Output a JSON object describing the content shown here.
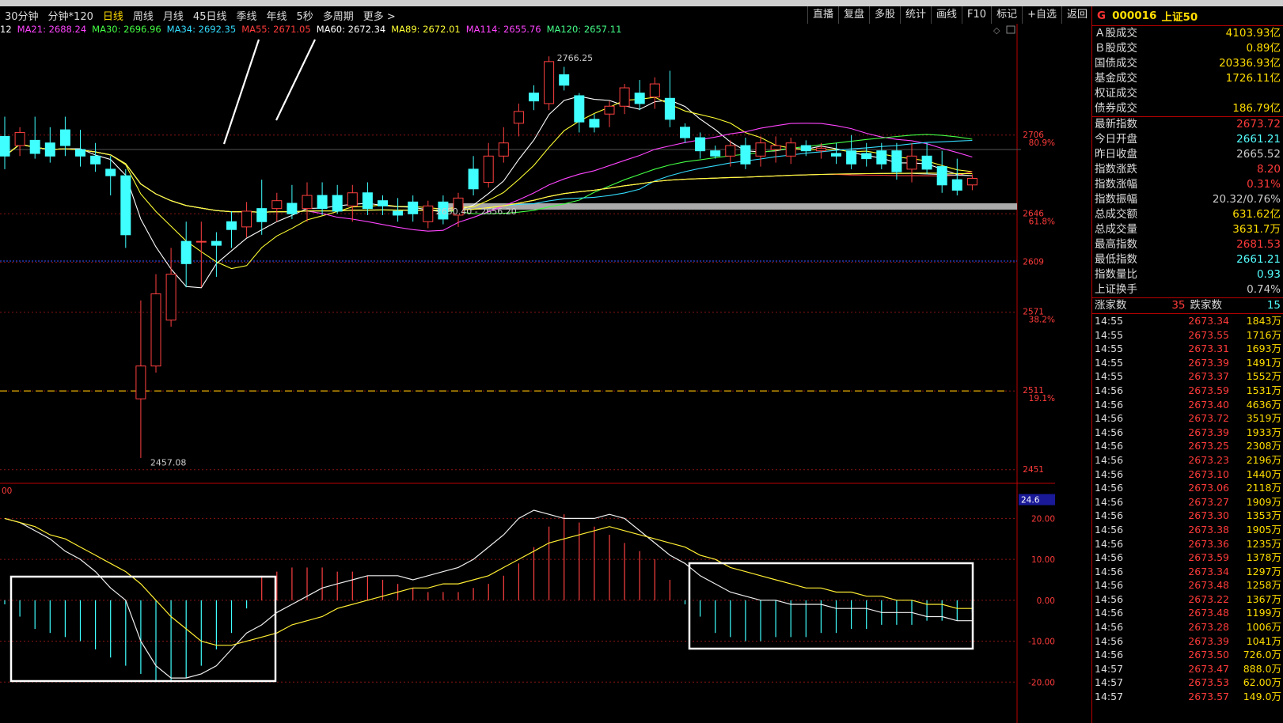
{
  "toolbar": {
    "periods": [
      "30分钟",
      "分钟*120",
      "日线",
      "周线",
      "月线",
      "45日线",
      "季线",
      "年线",
      "5秒",
      "多周期",
      "更多 >"
    ],
    "active_period": "日线",
    "tools": [
      "直播",
      "复盘",
      "多股",
      "统计",
      "画线",
      "F10",
      "标记",
      "+自选",
      "返回"
    ]
  },
  "ma_legend": [
    {
      "label": "12",
      "color": "#ffffff"
    },
    {
      "label": "MA21: 2688.24",
      "color": "#ff44ff"
    },
    {
      "label": "MA30: 2696.96",
      "color": "#44ff44"
    },
    {
      "label": "MA34: 2692.35",
      "color": "#33ddff"
    },
    {
      "label": "MA55: 2671.05",
      "color": "#ff3b3b"
    },
    {
      "label": "MA60: 2672.34",
      "color": "#ffffff"
    },
    {
      "label": "MA89: 2672.01",
      "color": "#ffff33"
    },
    {
      "label": "MA114: 2655.76",
      "color": "#ff44ff"
    },
    {
      "label": "MA120: 2657.11",
      "color": "#44ff88"
    }
  ],
  "chart_data": {
    "type": "candlestick",
    "price_axis_ticks": [
      {
        "value": "2706",
        "pct": "80.9%"
      },
      {
        "value": "2646",
        "pct": "61.8%"
      },
      {
        "value": "2609",
        "pct": ""
      },
      {
        "value": "2571",
        "pct": "38.2%"
      },
      {
        "value": "2511",
        "pct": "19.1%"
      },
      {
        "value": "2451",
        "pct": ""
      }
    ],
    "ylim": [
      2440,
      2780
    ],
    "annotations": {
      "high": "2766.25",
      "low": "2457.08",
      "range": "2650.40 - 2656.20"
    },
    "candles": [
      [
        2705,
        2720,
        2680,
        2690
      ],
      [
        2698,
        2712,
        2690,
        2708
      ],
      [
        2702,
        2720,
        2688,
        2692
      ],
      [
        2700,
        2712,
        2685,
        2690
      ],
      [
        2710,
        2720,
        2690,
        2698
      ],
      [
        2695,
        2710,
        2682,
        2690
      ],
      [
        2690,
        2700,
        2678,
        2684
      ],
      [
        2680,
        2690,
        2660,
        2675
      ],
      [
        2675,
        2680,
        2620,
        2630
      ],
      [
        2505,
        2580,
        2460,
        2530
      ],
      [
        2530,
        2600,
        2525,
        2585
      ],
      [
        2565,
        2620,
        2560,
        2600
      ],
      [
        2625,
        2640,
        2590,
        2608
      ],
      [
        2625,
        2640,
        2590,
        2625
      ],
      [
        2625,
        2632,
        2598,
        2622
      ],
      [
        2640,
        2648,
        2620,
        2634
      ],
      [
        2636,
        2655,
        2628,
        2648
      ],
      [
        2650,
        2672,
        2630,
        2640
      ],
      [
        2650,
        2662,
        2640,
        2656
      ],
      [
        2654,
        2668,
        2642,
        2646
      ],
      [
        2650,
        2670,
        2640,
        2660
      ],
      [
        2660,
        2670,
        2645,
        2650
      ],
      [
        2660,
        2668,
        2646,
        2648
      ],
      [
        2652,
        2668,
        2640,
        2662
      ],
      [
        2662,
        2670,
        2645,
        2650
      ],
      [
        2656,
        2660,
        2645,
        2652
      ],
      [
        2648,
        2658,
        2640,
        2645
      ],
      [
        2655,
        2660,
        2640,
        2646
      ],
      [
        2640,
        2656,
        2635,
        2652
      ],
      [
        2655,
        2660,
        2638,
        2642
      ],
      [
        2645,
        2662,
        2636,
        2658
      ],
      [
        2680,
        2690,
        2660,
        2665
      ],
      [
        2670,
        2700,
        2666,
        2690
      ],
      [
        2690,
        2712,
        2685,
        2700
      ],
      [
        2715,
        2730,
        2705,
        2724
      ],
      [
        2738,
        2744,
        2725,
        2732
      ],
      [
        2730,
        2766,
        2725,
        2762
      ],
      [
        2752,
        2758,
        2740,
        2744
      ],
      [
        2736,
        2738,
        2708,
        2716
      ],
      [
        2718,
        2722,
        2708,
        2712
      ],
      [
        2722,
        2732,
        2712,
        2728
      ],
      [
        2728,
        2745,
        2722,
        2742
      ],
      [
        2738,
        2748,
        2725,
        2730
      ],
      [
        2735,
        2750,
        2726,
        2745
      ],
      [
        2734,
        2755,
        2712,
        2718
      ],
      [
        2712,
        2715,
        2700,
        2704
      ],
      [
        2704,
        2708,
        2688,
        2694
      ],
      [
        2694,
        2698,
        2688,
        2690
      ],
      [
        2690,
        2702,
        2682,
        2698
      ],
      [
        2698,
        2704,
        2680,
        2684
      ],
      [
        2690,
        2705,
        2682,
        2700
      ],
      [
        2695,
        2705,
        2685,
        2698
      ],
      [
        2690,
        2704,
        2684,
        2700
      ],
      [
        2698,
        2702,
        2690,
        2694
      ],
      [
        2694,
        2700,
        2688,
        2696
      ],
      [
        2692,
        2700,
        2684,
        2690
      ],
      [
        2694,
        2706,
        2680,
        2684
      ],
      [
        2692,
        2700,
        2682,
        2688
      ],
      [
        2694,
        2700,
        2680,
        2684
      ],
      [
        2694,
        2700,
        2672,
        2678
      ],
      [
        2680,
        2700,
        2670,
        2690
      ],
      [
        2690,
        2700,
        2676,
        2680
      ],
      [
        2682,
        2694,
        2662,
        2668
      ],
      [
        2672,
        2688,
        2660,
        2664
      ],
      [
        2668,
        2676,
        2664,
        2673
      ]
    ],
    "macd_axis_ticks": [
      "24.6",
      "20.00",
      "10.00",
      "0.00",
      "-10.00",
      "-20.00"
    ],
    "macd_ylim": [
      -30,
      28
    ],
    "macd_hist": [
      -1,
      -4,
      -7,
      -8,
      -9,
      -10,
      -12,
      -14,
      -16,
      -18,
      -20,
      -20,
      -19,
      -16,
      -12,
      -8,
      -2,
      6,
      7,
      8,
      8,
      8,
      7,
      7,
      6,
      5,
      4,
      3,
      2,
      2,
      2,
      3,
      4,
      6,
      9,
      13,
      18,
      21,
      19,
      18,
      16,
      14,
      12,
      10,
      5,
      -1,
      -4,
      -8,
      -9,
      -10,
      -10,
      -9,
      -9,
      -9,
      -8,
      -8,
      -7,
      -7,
      -6,
      -6,
      -6,
      -5,
      -5,
      -5,
      -3
    ],
    "macd_dif": [
      20,
      19,
      17,
      15,
      12,
      10,
      7,
      3,
      0,
      -10,
      -16,
      -19,
      -19,
      -18,
      -16,
      -12,
      -8,
      -6,
      -3,
      -1,
      1,
      3,
      4,
      5,
      6,
      6,
      6,
      5,
      6,
      7,
      8,
      10,
      13,
      16,
      20,
      22,
      21,
      20,
      20,
      20,
      21,
      20,
      17,
      14,
      11,
      9,
      6,
      4,
      2,
      1,
      0,
      0,
      -1,
      -1,
      -1,
      -2,
      -2,
      -2,
      -3,
      -3,
      -3,
      -4,
      -4,
      -5,
      -5
    ],
    "macd_dea": [
      20,
      19,
      18,
      16,
      15,
      13,
      11,
      9,
      7,
      4,
      0,
      -4,
      -7,
      -10,
      -11,
      -11,
      -10,
      -9,
      -8,
      -6,
      -5,
      -4,
      -2,
      -1,
      0,
      1,
      2,
      3,
      3,
      4,
      4,
      5,
      6,
      8,
      10,
      12,
      14,
      15,
      16,
      17,
      18,
      17,
      16,
      15,
      14,
      13,
      11,
      10,
      8,
      7,
      6,
      5,
      4,
      3,
      3,
      2,
      2,
      1,
      1,
      0,
      0,
      -1,
      -1,
      -2,
      -2
    ]
  },
  "right_panel": {
    "flag": "G",
    "code": "000016",
    "name": "上证50",
    "stats": [
      {
        "label": "Ａ股成交",
        "value": "4103.93亿",
        "cls": "ylw"
      },
      {
        "label": "Ｂ股成交",
        "value": "0.89亿",
        "cls": "ylw"
      },
      {
        "label": "国债成交",
        "value": "20336.93亿",
        "cls": "ylw"
      },
      {
        "label": "基金成交",
        "value": "1726.11亿",
        "cls": "ylw"
      },
      {
        "label": "权证成交",
        "value": "",
        "cls": "ylw"
      },
      {
        "label": "债券成交",
        "value": "186.79亿",
        "cls": "ylw"
      }
    ],
    "quotes": [
      {
        "label": "最新指数",
        "value": "2673.72",
        "cls": "upc"
      },
      {
        "label": "今日开盘",
        "value": "2661.21",
        "cls": "cyan"
      },
      {
        "label": "昨日收盘",
        "value": "2665.52",
        "cls": ""
      },
      {
        "label": "指数涨跌",
        "value": "8.20",
        "cls": "upc"
      },
      {
        "label": "指数涨幅",
        "value": "0.31%",
        "cls": "upc"
      },
      {
        "label": "指数振幅",
        "value": "20.32/0.76%",
        "cls": ""
      },
      {
        "label": "总成交额",
        "value": "631.62亿",
        "cls": "ylw"
      },
      {
        "label": "总成交量",
        "value": "3631.7万",
        "cls": "ylw"
      },
      {
        "label": "最高指数",
        "value": "2681.53",
        "cls": "upc"
      },
      {
        "label": "最低指数",
        "value": "2661.21",
        "cls": "cyan"
      },
      {
        "label": "指数量比",
        "value": "0.93",
        "cls": "cyan"
      },
      {
        "label": "上证换手",
        "value": "0.74%",
        "cls": ""
      }
    ],
    "updown": {
      "up_label": "涨家数",
      "up_value": "35",
      "down_label": "跌家数",
      "down_value": "15"
    },
    "ticks": [
      {
        "t": "14:55",
        "p": "2673.34",
        "v": "1843万"
      },
      {
        "t": "14:55",
        "p": "2673.55",
        "v": "1716万"
      },
      {
        "t": "14:55",
        "p": "2673.31",
        "v": "1693万"
      },
      {
        "t": "14:55",
        "p": "2673.39",
        "v": "1491万"
      },
      {
        "t": "14:55",
        "p": "2673.37",
        "v": "1552万"
      },
      {
        "t": "14:56",
        "p": "2673.59",
        "v": "1531万"
      },
      {
        "t": "14:56",
        "p": "2673.40",
        "v": "4636万"
      },
      {
        "t": "14:56",
        "p": "2673.72",
        "v": "3519万"
      },
      {
        "t": "14:56",
        "p": "2673.39",
        "v": "1933万"
      },
      {
        "t": "14:56",
        "p": "2673.25",
        "v": "2308万"
      },
      {
        "t": "14:56",
        "p": "2673.23",
        "v": "2196万"
      },
      {
        "t": "14:56",
        "p": "2673.10",
        "v": "1440万"
      },
      {
        "t": "14:56",
        "p": "2673.06",
        "v": "2118万"
      },
      {
        "t": "14:56",
        "p": "2673.27",
        "v": "1909万"
      },
      {
        "t": "14:56",
        "p": "2673.30",
        "v": "1353万"
      },
      {
        "t": "14:56",
        "p": "2673.38",
        "v": "1905万"
      },
      {
        "t": "14:56",
        "p": "2673.36",
        "v": "1235万"
      },
      {
        "t": "14:56",
        "p": "2673.59",
        "v": "1378万"
      },
      {
        "t": "14:56",
        "p": "2673.34",
        "v": "1297万"
      },
      {
        "t": "14:56",
        "p": "2673.48",
        "v": "1258万"
      },
      {
        "t": "14:56",
        "p": "2673.22",
        "v": "1367万"
      },
      {
        "t": "14:56",
        "p": "2673.48",
        "v": "1199万"
      },
      {
        "t": "14:56",
        "p": "2673.28",
        "v": "1006万"
      },
      {
        "t": "14:56",
        "p": "2673.39",
        "v": "1041万"
      },
      {
        "t": "14:56",
        "p": "2673.50",
        "v": "726.0万"
      },
      {
        "t": "14:57",
        "p": "2673.47",
        "v": "888.0万"
      },
      {
        "t": "14:57",
        "p": "2673.53",
        "v": "62.00万"
      },
      {
        "t": "14:57",
        "p": "2673.57",
        "v": "149.0万"
      }
    ]
  },
  "macd_label": "00"
}
